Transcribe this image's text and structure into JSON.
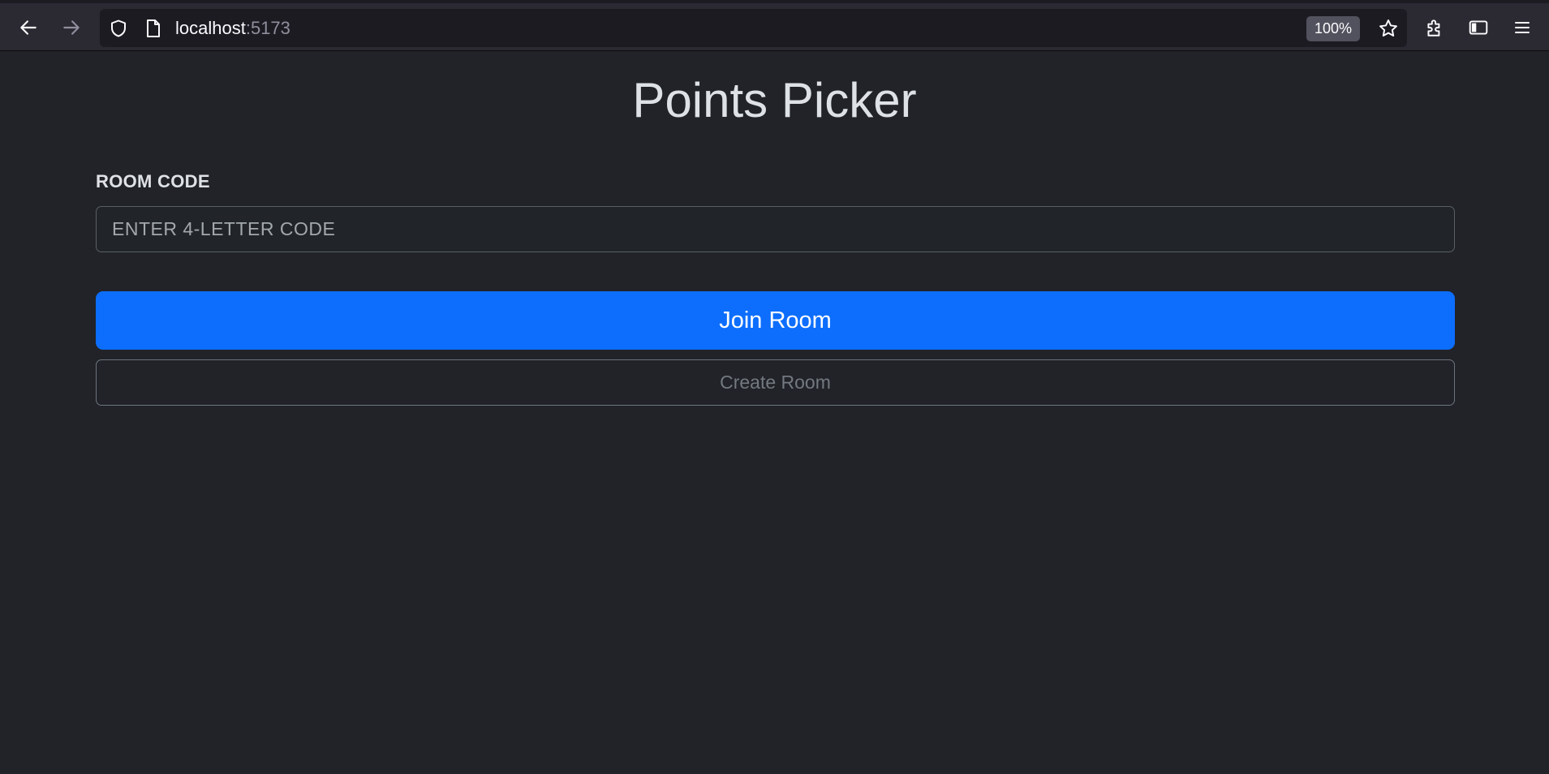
{
  "browser": {
    "url_host": "localhost",
    "url_port": ":5173",
    "zoom": "100%",
    "icons": {
      "back": "arrow-left-icon",
      "forward": "arrow-right-icon",
      "shield": "shield-icon",
      "page": "page-icon",
      "bookmark": "star-icon",
      "extensions": "puzzle-icon",
      "sidebar": "sidebar-icon",
      "menu": "hamburger-menu-icon"
    }
  },
  "app": {
    "title": "Points Picker",
    "room_code_label": "ROOM CODE",
    "room_code_input": {
      "value": "",
      "placeholder": "ENTER 4-LETTER CODE"
    },
    "join_button_label": "Join Room",
    "create_button_label": "Create Room"
  },
  "colors": {
    "background": "#212328",
    "primary": "#0d6efd",
    "text": "#dee2e6",
    "secondary": "#6c757d"
  }
}
